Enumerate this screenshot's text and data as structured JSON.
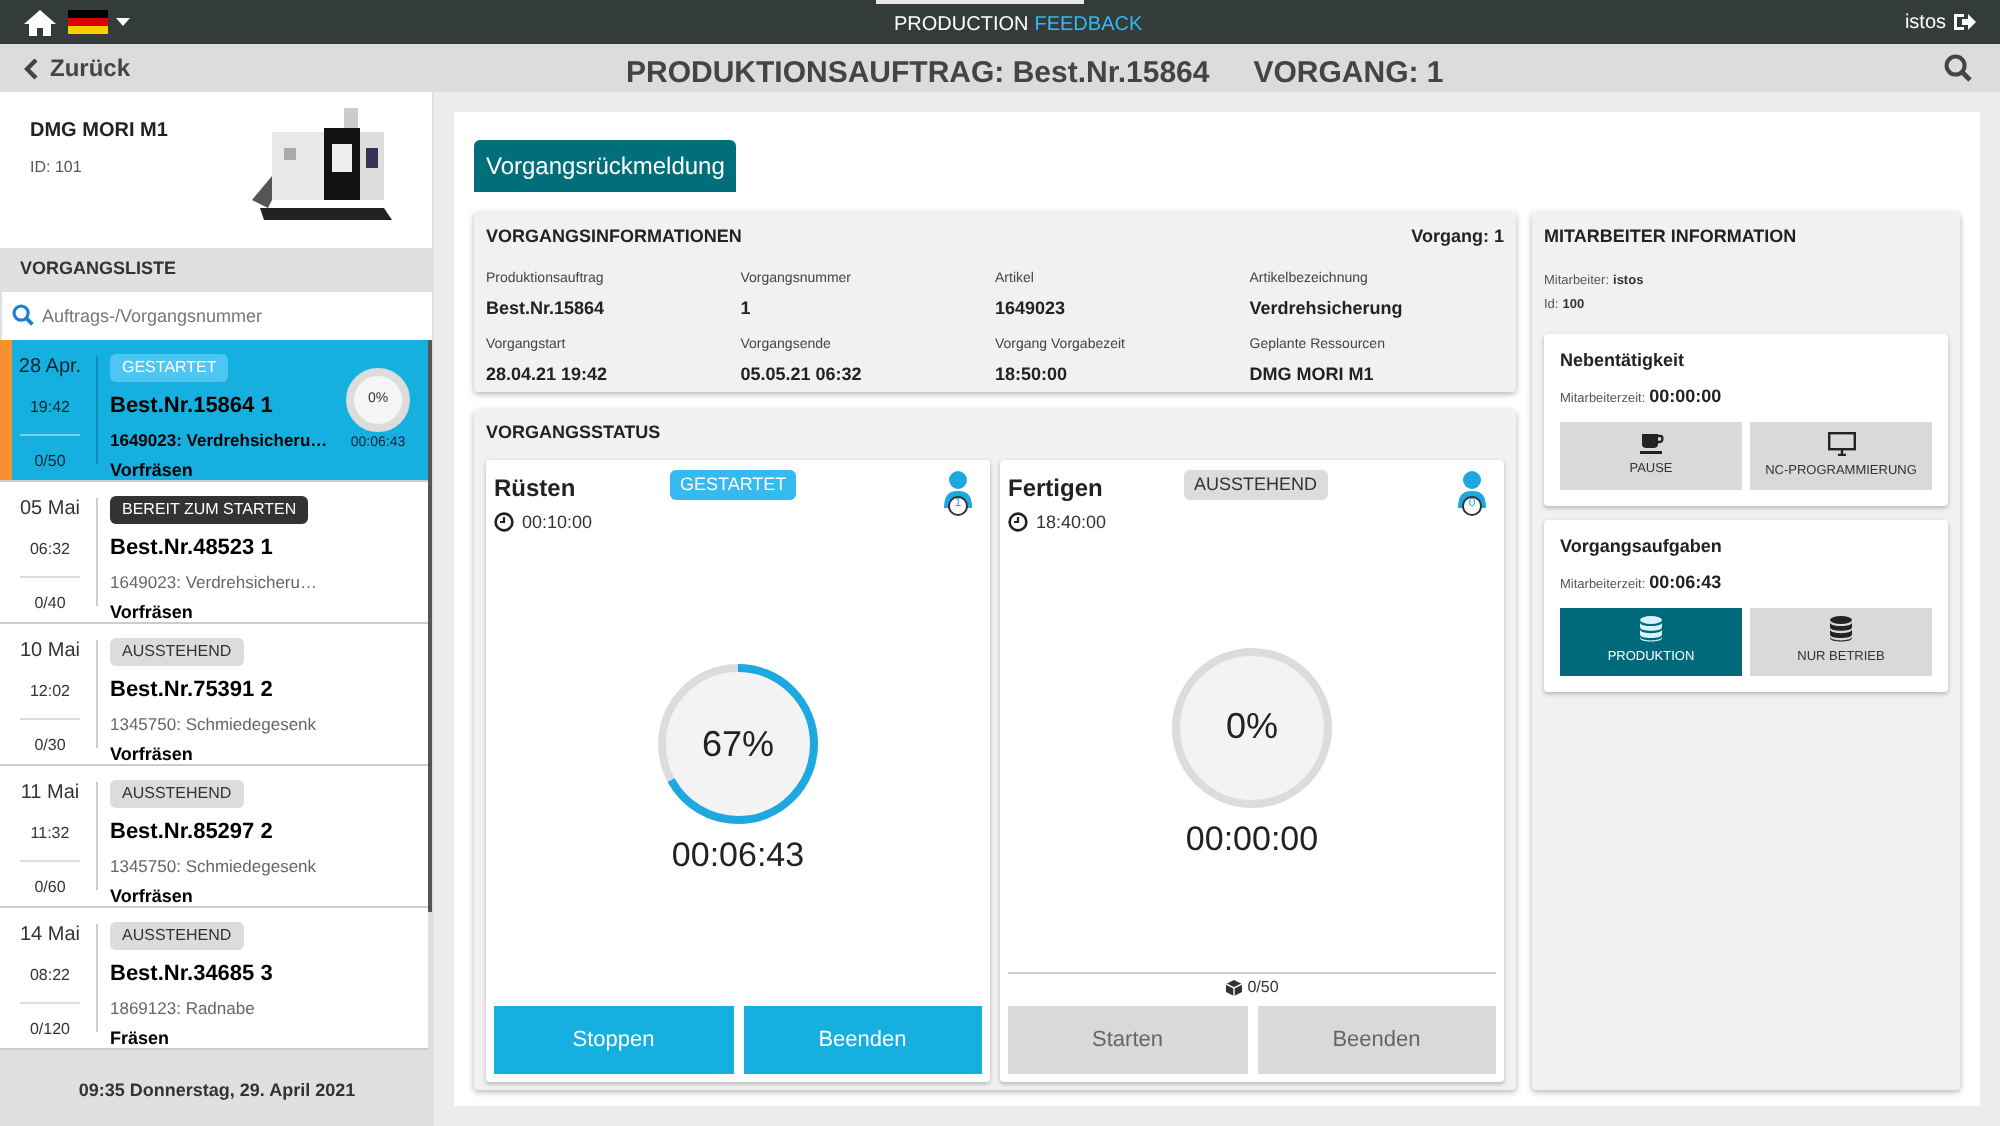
{
  "topbar": {
    "title": "PRODUCTION",
    "title_accent": "FEEDBACK",
    "user": "istos"
  },
  "header": {
    "back": "Zurück",
    "title": "PRODUKTIONSAUFTRAG: Best.Nr.15864",
    "operation": "VORGANG: 1"
  },
  "machine": {
    "name": "DMG MORI M1",
    "id": "ID: 101"
  },
  "list": {
    "title": "VORGANGSLISTE",
    "search_placeholder": "Auftrags-/Vorgangsnummer",
    "items": [
      {
        "date": "28 Apr.",
        "time": "19:42",
        "qty": "0/50",
        "status": "GESTARTET",
        "kind": "started",
        "order": "Best.Nr.15864 1",
        "article": "1649023: Verdrehsicheru…",
        "step": "Vorfräsen",
        "selected": true,
        "progress": {
          "label": "0%",
          "time": "00:06:43",
          "level": 0
        }
      },
      {
        "date": "05 Mai",
        "time": "06:32",
        "qty": "0/40",
        "status": "BEREIT ZUM STARTEN",
        "kind": "ready",
        "order": "Best.Nr.48523 1",
        "article": "1649023: Verdrehsicheru…",
        "step": "Vorfräsen",
        "selected": false
      },
      {
        "date": "10 Mai",
        "time": "12:02",
        "qty": "0/30",
        "status": "AUSSTEHEND",
        "kind": "pending",
        "order": "Best.Nr.75391 2",
        "article": "1345750: Schmiedegesenk",
        "step": "Vorfräsen",
        "selected": false
      },
      {
        "date": "11 Mai",
        "time": "11:32",
        "qty": "0/60",
        "status": "AUSSTEHEND",
        "kind": "pending",
        "order": "Best.Nr.85297 2",
        "article": "1345750: Schmiedegesenk",
        "step": "Vorfräsen",
        "selected": false
      },
      {
        "date": "14 Mai",
        "time": "08:22",
        "qty": "0/120",
        "status": "AUSSTEHEND",
        "kind": "pending",
        "order": "Best.Nr.34685 3",
        "article": "1869123: Radnabe",
        "step": "Fräsen",
        "selected": false
      }
    ]
  },
  "footer": "09:35 Donnerstag, 29. April 2021",
  "tabs": [
    {
      "label": "Vorgangsrückmeldung",
      "selected": true
    }
  ],
  "info": {
    "title": "VORGANGSINFORMATIONEN",
    "operation": "Vorgang: 1",
    "fields": [
      {
        "label": "Produktionsauftrag",
        "value": "Best.Nr.15864"
      },
      {
        "label": "Vorgangsnummer",
        "value": "1"
      },
      {
        "label": "Artikel",
        "value": "1649023"
      },
      {
        "label": "Artikelbezeichnung",
        "value": "Verdrehsicherung"
      },
      {
        "label": "Vorgangstart",
        "value": "28.04.21 19:42"
      },
      {
        "label": "Vorgangsende",
        "value": "05.05.21 06:32"
      },
      {
        "label": "Vorgang Vorgabezeit",
        "value": "18:50:00"
      },
      {
        "label": "Geplante Ressourcen",
        "value": "DMG MORI M1"
      }
    ]
  },
  "status": {
    "title": "VORGANGSSTATUS",
    "phases": [
      {
        "name": "Rüsten",
        "badge": "GESTARTET",
        "kind": "started",
        "planned": "00:10:00",
        "workers": "1",
        "level": 0.67,
        "percent": "67%",
        "elapsed": "00:06:43",
        "buttons": [
          {
            "label": "Stoppen",
            "disabled": false
          },
          {
            "label": "Beenden",
            "disabled": false
          }
        ]
      },
      {
        "name": "Fertigen",
        "badge": "AUSSTEHEND",
        "kind": "pending",
        "planned": "18:40:00",
        "workers": "0",
        "level": 0,
        "percent": "0%",
        "elapsed": "00:00:00",
        "quantity": "0/50",
        "buttons": [
          {
            "label": "Starten",
            "disabled": true
          },
          {
            "label": "Beenden",
            "disabled": true
          }
        ]
      }
    ]
  },
  "employee": {
    "title": "MITARBEITER INFORMATION",
    "employee_label": "Mitarbeiter:",
    "employee": "istos",
    "id_label": "Id:",
    "id": "100",
    "sections": [
      {
        "title": "Nebentätigkeit",
        "time_label": "Mitarbeiterzeit:",
        "time": "00:00:00",
        "buttons": [
          {
            "label": "PAUSE",
            "kind": "cup",
            "selected": false
          },
          {
            "label": "NC-PROGRAMMIERUNG",
            "kind": "monitor",
            "selected": false
          }
        ]
      },
      {
        "title": "Vorgangsaufgaben",
        "time_label": "Mitarbeiterzeit:",
        "time": "00:06:43",
        "buttons": [
          {
            "label": "PRODUKTION",
            "kind": "database",
            "selected": true
          },
          {
            "label": "NUR BETRIEB",
            "kind": "database",
            "selected": false
          }
        ]
      }
    ]
  }
}
